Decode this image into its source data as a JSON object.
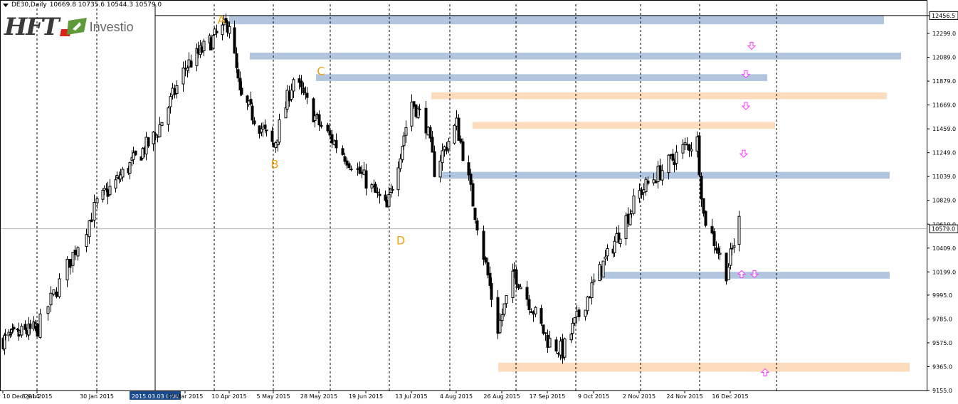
{
  "info": {
    "symbol": "DE30,Daily",
    "ohlc": "10669.8 10735.6 10544.3 10579.0"
  },
  "logo": {
    "brand": "HFT",
    "sub": "Investio"
  },
  "colors": {
    "blue_zone": "#b2c5df",
    "orange_zone": "#fcdcbc",
    "arrow": "#ff33ff",
    "label": "#f2a20f",
    "bull": "#ffffff",
    "bear": "#000000",
    "grid": "#000000",
    "crosshair": "#b4b4b4"
  },
  "chart_data": {
    "type": "candlestick",
    "symbol": "DE30",
    "timeframe": "Daily",
    "current_price": 10579.0,
    "top_price_marker": 12456.5,
    "y_ticks": [
      12456.5,
      12299.0,
      12089.0,
      11879.0,
      11669.0,
      11459.0,
      11249.0,
      11039.0,
      10829.0,
      10619.0,
      10409.0,
      10199.0,
      9995.0,
      9785.0,
      9575.0,
      9365.0,
      9155.0
    ],
    "x_labels": [
      "10 Dec 2014",
      "8 Jan 2015",
      "30 Jan 2015",
      "2015.03.03 0:00",
      "17 Mar 2015",
      "10 Apr 2015",
      "5 May 2015",
      "28 May 2015",
      "19 Jun 2015",
      "13 Jul 2015",
      "4 Aug 2015",
      "26 Aug 2015",
      "17 Sep 2015",
      "9 Oct 2015",
      "2 Nov 2015",
      "24 Nov 2015",
      "16 Dec 2015"
    ],
    "highlighted_x_label": "2015.03.03 0:00",
    "wave_labels": [
      {
        "text": "A",
        "price": 12420
      },
      {
        "text": "B",
        "price": 11150
      },
      {
        "text": "C",
        "price": 11970
      },
      {
        "text": "D",
        "price": 10480
      }
    ],
    "zones": [
      {
        "kind": "resistance",
        "color": "blue",
        "low": 12380,
        "high": 12460
      },
      {
        "kind": "resistance",
        "color": "blue",
        "low": 12070,
        "high": 12130
      },
      {
        "kind": "resistance",
        "color": "blue",
        "low": 11880,
        "high": 11940
      },
      {
        "kind": "resistance",
        "color": "orange",
        "low": 11720,
        "high": 11780
      },
      {
        "kind": "resistance",
        "color": "orange",
        "low": 11460,
        "high": 11520
      },
      {
        "kind": "pivot",
        "color": "blue",
        "low": 11020,
        "high": 11080
      },
      {
        "kind": "support",
        "color": "blue",
        "low": 10140,
        "high": 10200
      },
      {
        "kind": "support",
        "color": "orange",
        "low": 9320,
        "high": 9400
      }
    ],
    "arrows": [
      {
        "dir": "down",
        "price": 12190
      },
      {
        "dir": "down",
        "price": 11940
      },
      {
        "dir": "down",
        "price": 11660
      },
      {
        "dir": "down",
        "price": 11240
      },
      {
        "dir": "up",
        "price": 10180
      },
      {
        "dir": "down",
        "price": 10180
      },
      {
        "dir": "up",
        "price": 9315
      }
    ],
    "anchors": [
      {
        "date": "10 Dec 2014",
        "price": 9600
      },
      {
        "date": "8 Jan 2015",
        "price": 9700
      },
      {
        "date": "30 Jan 2015",
        "price": 10800
      },
      {
        "date": "3 Mar 2015",
        "price": 11400
      },
      {
        "date": "17 Mar 2015",
        "price": 12000
      },
      {
        "date": "10 Apr 2015",
        "price": 12400
      },
      {
        "date": "16 Apr 2015",
        "price": 11750
      },
      {
        "date": "5 May 2015",
        "price": 11300
      },
      {
        "date": "15 May 2015",
        "price": 11900
      },
      {
        "date": "28 May 2015",
        "price": 11500
      },
      {
        "date": "19 Jun 2015",
        "price": 11000
      },
      {
        "date": "30 Jun 2015",
        "price": 10750
      },
      {
        "date": "13 Jul 2015",
        "price": 11700
      },
      {
        "date": "20 Jul 2015",
        "price": 11500
      },
      {
        "date": "24 Jul 2015",
        "price": 11100
      },
      {
        "date": "4 Aug 2015",
        "price": 11500
      },
      {
        "date": "10 Aug 2015",
        "price": 11000
      },
      {
        "date": "24 Aug 2015",
        "price": 9700
      },
      {
        "date": "1 Sep 2015",
        "price": 10200
      },
      {
        "date": "17 Sep 2015",
        "price": 9600
      },
      {
        "date": "24 Sep 2015",
        "price": 9500
      },
      {
        "date": "9 Oct 2015",
        "price": 10100
      },
      {
        "date": "2 Nov 2015",
        "price": 10900
      },
      {
        "date": "24 Nov 2015",
        "price": 11300
      },
      {
        "date": "30 Nov 2015",
        "price": 11350
      },
      {
        "date": "3 Dec 2015",
        "price": 10700
      },
      {
        "date": "14 Dec 2015",
        "price": 10200
      },
      {
        "date": "21 Dec 2015",
        "price": 10650
      }
    ]
  }
}
